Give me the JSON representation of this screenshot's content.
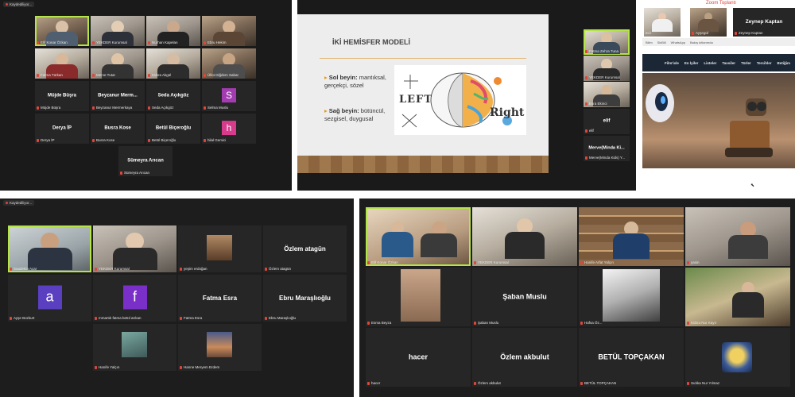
{
  "panel1": {
    "rec_label": "Kaydediliyor...",
    "video_tiles": [
      {
        "name": "Elif Konar Özkan"
      },
      {
        "name": "YEKDER Kurumsal"
      },
      {
        "name": "Nurhan Kapelan"
      },
      {
        "name": "Ebru Hekim"
      },
      {
        "name": "Fatma Türkan"
      },
      {
        "name": "Merve Tutar"
      },
      {
        "name": "Kübra Akgül"
      },
      {
        "name": "Ülkü Diğdem Sabar"
      }
    ],
    "text_tiles": [
      {
        "title": "Müjde Büşra",
        "name": "Müjde Büşra"
      },
      {
        "title": "Beyzanur Merm...",
        "name": "Beyzanur Mermerkaya"
      },
      {
        "title": "Seda Açıkgöz",
        "name": "Seda Açıkgöz"
      },
      {
        "title": "S",
        "name": "Selma Muslu",
        "color": "#a23cb0"
      },
      {
        "title": "Derya İP",
        "name": "Derya İP"
      },
      {
        "title": "Busra Kose",
        "name": "Busra Kose"
      },
      {
        "title": "Betül Biçeroğlu",
        "name": "Betül Biçeroğlu"
      },
      {
        "title": "h",
        "name": "hilal Gemici",
        "color": "#d83b8c"
      },
      {
        "title": "Sümeyra Arıcan",
        "name": "Sümeyra Arıcan"
      }
    ]
  },
  "panel2": {
    "slide_title": "İKİ HEMİSFER MODELİ",
    "bullet1_bold": "Sol beyin:",
    "bullet1_text": "mantıksal, gerçekçi, sözel",
    "bullet2_bold": "Sağ beyin:",
    "bullet2_text": "bütüncül, sezgisel, duygusal",
    "brain_left": "LEFT",
    "brain_right": "Right",
    "side_tiles": [
      {
        "name": "Fatma Zehra Tuna",
        "title": ""
      },
      {
        "name": "YEKDER Kurumsal",
        "title": ""
      },
      {
        "name": "Esra Ekinci",
        "title": ""
      },
      {
        "name": "elif",
        "title": "elif"
      },
      {
        "name": "Merve(Minda Kids) Y...",
        "title": "Merve(Minda Ki..."
      }
    ]
  },
  "panel3": {
    "window_title": "Zoom Toplantı",
    "thumb1": "ecii",
    "thumb2": "Ayşegül",
    "thumb3_title": "Zeynep Kaptan",
    "thumb3_name": "Zeynep Kaptan",
    "tabs": [
      "Bilim",
      "SkiBill",
      "WhatsApp",
      "Bakış kıtlarımda"
    ],
    "nav": [
      "Film'ixle",
      "En İyiler",
      "Listeler",
      "Tavsiler",
      "Türler",
      "Tercihler",
      "Betiğim"
    ]
  },
  "panel4": {
    "rec_label": "Kaydediliyor...",
    "video_tiles": [
      {
        "name": "Saadettin Acar"
      },
      {
        "name": "YEKDER Kurumsal"
      },
      {
        "name": "yeşim erdoğan"
      },
      {
        "name": "Hanife Yalçın"
      },
      {
        "name": "Hanne Meryem Erdem"
      }
    ],
    "text_tiles": [
      {
        "title": "Özlem atagün",
        "name": "Özlem atagün"
      },
      {
        "title": "a",
        "name": "Ayşe Bozkurt",
        "color": "#5a3fc0"
      },
      {
        "title": "f",
        "name": "mmartık fatma betül arıkan",
        "color": "#7a2fc8"
      },
      {
        "title": "Fatma Esra",
        "name": "Fatma Esra"
      },
      {
        "title": "Ebru Maraşlıoğlu",
        "name": "Ebru Maraşlıoğlu"
      }
    ]
  },
  "panel5": {
    "video_tiles": [
      {
        "name": "Elif Konar Özkan"
      },
      {
        "name": "YEKDER Kurumsal"
      },
      {
        "name": "Hanife Arfat Yalçın"
      },
      {
        "name": "yasin"
      },
      {
        "name": "Esma Beyza"
      },
      {
        "name": "Hafsa Öz..."
      },
      {
        "name": "Kübra Nur Kayır"
      },
      {
        "name": "Sıdıka Nur Yılmaz"
      }
    ],
    "text_tiles": [
      {
        "title": "Şaban Muslu",
        "name": "Şaban Muslu"
      },
      {
        "title": "hacer",
        "name": "hacer"
      },
      {
        "title": "Özlem akbulut",
        "name": "Özlem akbulut"
      },
      {
        "title": "BETÜL TOPÇAKAN",
        "name": "BETÜL TOPÇAKAN"
      }
    ]
  }
}
